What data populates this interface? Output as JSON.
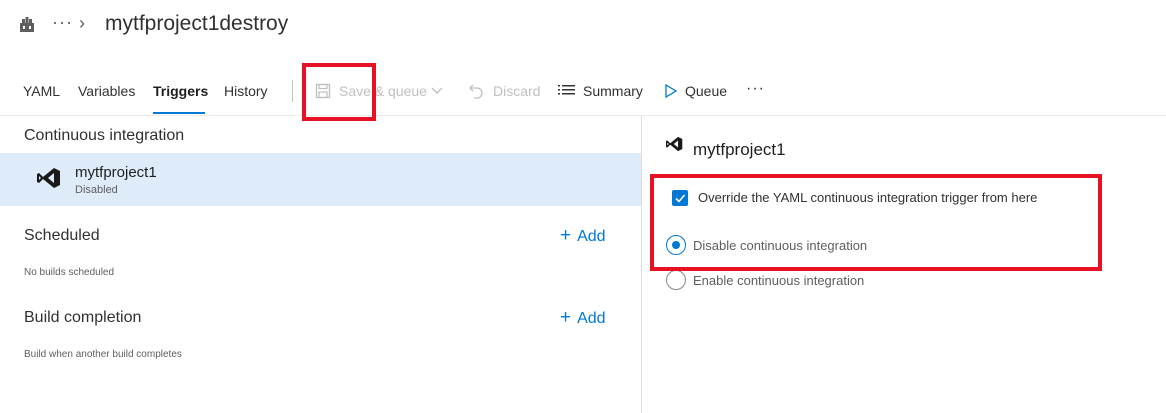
{
  "header": {
    "breadcrumb_ellipsis": "···",
    "breadcrumb_separator": "›",
    "title": "mytfproject1destroy"
  },
  "toolbar": {
    "tabs": [
      {
        "label": "YAML",
        "active": false
      },
      {
        "label": "Variables",
        "active": false
      },
      {
        "label": "Triggers",
        "active": true
      },
      {
        "label": "History",
        "active": false
      }
    ],
    "save_queue_label": "Save & queue",
    "discard_label": "Discard",
    "summary_label": "Summary",
    "queue_label": "Queue",
    "more_label": "···"
  },
  "left": {
    "ci": {
      "title": "Continuous integration",
      "repo": {
        "name": "mytfproject1",
        "status": "Disabled"
      }
    },
    "scheduled": {
      "title": "Scheduled",
      "add_label": "Add",
      "note": "No builds scheduled"
    },
    "build_completion": {
      "title": "Build completion",
      "add_label": "Add",
      "note": "Build when another build completes"
    }
  },
  "right": {
    "title": "mytfproject1",
    "override_label": "Override the YAML continuous integration trigger from here",
    "override_checked": true,
    "options": [
      {
        "label": "Disable continuous integration",
        "selected": true
      },
      {
        "label": "Enable continuous integration",
        "selected": false
      }
    ]
  },
  "colors": {
    "accent": "#0078d4",
    "selected_row": "#deecf9",
    "highlight_box": "#e81123"
  }
}
